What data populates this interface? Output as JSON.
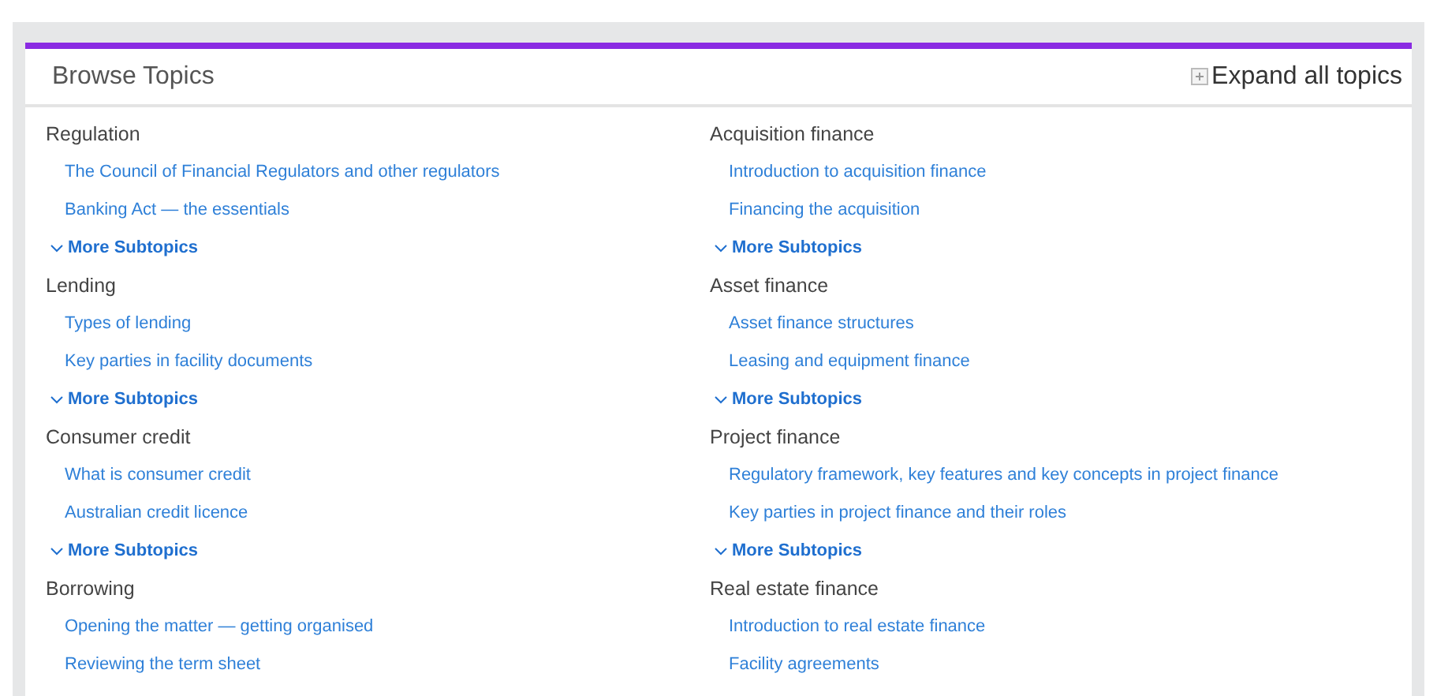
{
  "panel": {
    "title": "Browse Topics",
    "expand_link": "Expand all topics"
  },
  "columns": [
    [
      {
        "title": "Regulation",
        "subtopics": [
          "The Council of Financial Regulators and other regulators",
          "Banking Act — the essentials"
        ],
        "more": "More Subtopics"
      },
      {
        "title": "Lending",
        "subtopics": [
          "Types of lending",
          "Key parties in facility documents"
        ],
        "more": "More Subtopics"
      },
      {
        "title": "Consumer credit",
        "subtopics": [
          "What is consumer credit",
          "Australian credit licence"
        ],
        "more": "More Subtopics"
      },
      {
        "title": "Borrowing",
        "subtopics": [
          "Opening the matter — getting organised",
          "Reviewing the term sheet"
        ]
      }
    ],
    [
      {
        "title": "Acquisition finance",
        "subtopics": [
          "Introduction to acquisition finance",
          "Financing the acquisition"
        ],
        "more": "More Subtopics"
      },
      {
        "title": "Asset finance",
        "subtopics": [
          "Asset finance structures",
          "Leasing and equipment finance"
        ],
        "more": "More Subtopics"
      },
      {
        "title": "Project finance",
        "subtopics": [
          "Regulatory framework, key features and key concepts in project finance",
          "Key parties in project finance and their roles"
        ],
        "more": "More Subtopics"
      },
      {
        "title": "Real estate finance",
        "subtopics": [
          "Introduction to real estate finance",
          "Facility agreements"
        ]
      }
    ]
  ]
}
